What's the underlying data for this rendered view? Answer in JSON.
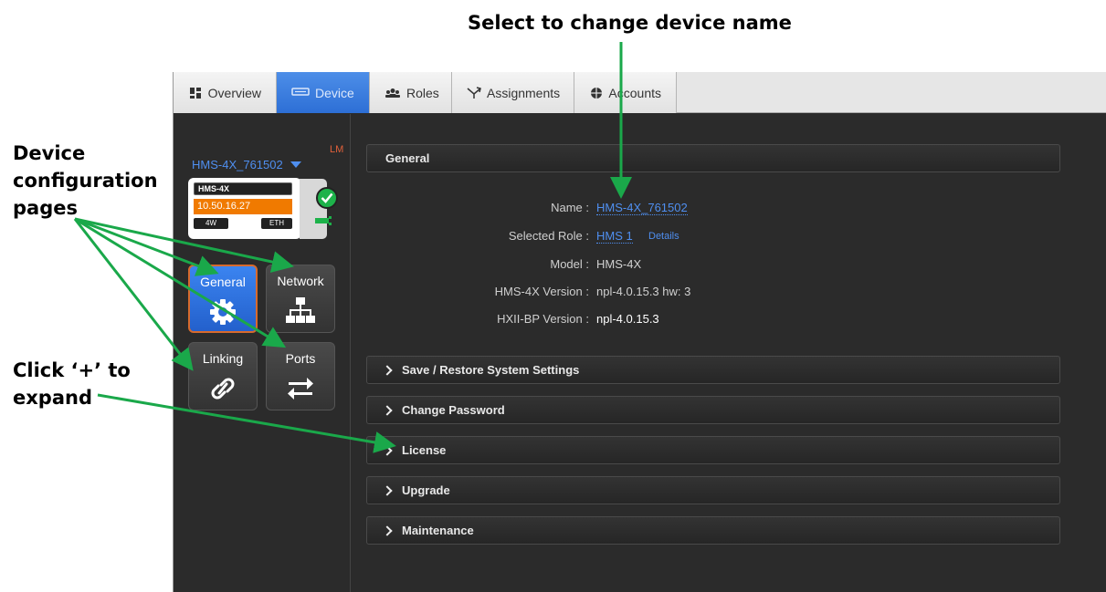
{
  "annotations": {
    "top": "Select to change device name",
    "device_config": [
      "Device",
      "configuration",
      "pages"
    ],
    "click_expand": [
      "Click ‘+’ to",
      "expand"
    ]
  },
  "tabs": [
    {
      "label": "Overview",
      "icon": "dashboard-icon",
      "active": false
    },
    {
      "label": "Device",
      "icon": "device-icon",
      "active": true
    },
    {
      "label": "Roles",
      "icon": "users-icon",
      "active": false
    },
    {
      "label": "Assignments",
      "icon": "assignments-icon",
      "active": false
    },
    {
      "label": "Accounts",
      "icon": "globe-icon",
      "active": false
    }
  ],
  "sidebar": {
    "lm": "LM",
    "device_name": "HMS-4X_761502",
    "card": {
      "name": "HMS-4X",
      "ip": "10.50.16.27",
      "left_tag": "4W",
      "right_tag": "ETH"
    },
    "nav": [
      {
        "label": "General",
        "icon": "gear-icon",
        "active": true
      },
      {
        "label": "Network",
        "icon": "network-icon",
        "active": false
      },
      {
        "label": "Linking",
        "icon": "link-icon",
        "active": false
      },
      {
        "label": "Ports",
        "icon": "ports-arrows-icon",
        "active": false
      }
    ]
  },
  "general": {
    "title": "General",
    "rows": [
      {
        "label": "Name :",
        "value": "HMS-4X_761502"
      },
      {
        "label": "Selected Role :",
        "value": "HMS 1",
        "extra": "Details"
      },
      {
        "label": "Model :",
        "value": "HMS-4X"
      },
      {
        "label": "HMS-4X Version :",
        "value": "npl-4.0.15.3 hw: 3"
      },
      {
        "label": "HXII-BP Version :",
        "value": "npl-4.0.15.3"
      }
    ]
  },
  "sections": [
    "Save / Restore System Settings",
    "Change Password",
    "License",
    "Upgrade",
    "Maintenance"
  ],
  "colors": {
    "accent": "#2d6fd6",
    "link": "#4f8ff0",
    "orange": "#f07a00",
    "status_green": "#1db24a",
    "arrow_green": "#1aa84a",
    "lm_red": "#e0603a"
  }
}
